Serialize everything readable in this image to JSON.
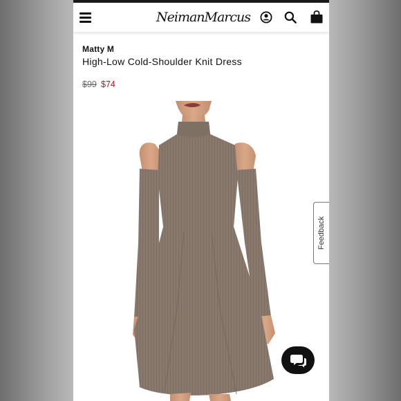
{
  "header": {
    "logo_text": "NeimanMarcus",
    "icons": [
      "menu-icon",
      "account-icon",
      "search-icon",
      "shopping-bag-icon"
    ]
  },
  "product": {
    "brand": "Matty M",
    "name": "High-Low Cold-Shoulder Knit Dress",
    "original_price": "$99",
    "sale_price": "$74",
    "image_subject": "model wearing taupe ribbed cold-shoulder high-low knit dress"
  },
  "feedback": {
    "label": "Feedback"
  },
  "chat": {
    "icon": "chat-bubbles-icon"
  },
  "colors": {
    "sale_price": "#b0181e",
    "dress": "#8a7a6e",
    "header_text": "#111111",
    "chat_button": "#111111"
  }
}
